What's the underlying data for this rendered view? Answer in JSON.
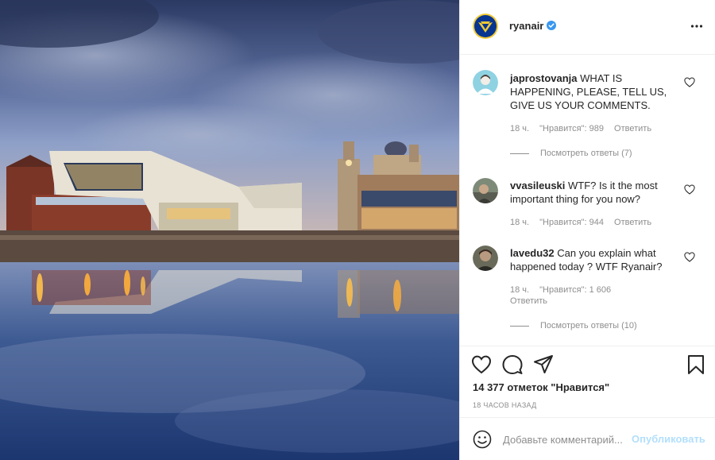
{
  "post": {
    "author": {
      "username": "ryanair",
      "verified": true
    }
  },
  "comments": [
    {
      "username": "japrostovanja",
      "text": "WHAT IS HAPPENING, PLEASE, TELL US, GIVE US YOUR COMMENTS.",
      "time": "18 ч.",
      "likes": "\"Нравится\": 989",
      "reply": "Ответить",
      "view_replies": "Посмотреть ответы (7)"
    },
    {
      "username": "vvasileuski",
      "text": "WTF? Is it the most important thing for you now?",
      "time": "18 ч.",
      "likes": "\"Нравится\": 944",
      "reply": "Ответить"
    },
    {
      "username": "lavedu32",
      "text": "Can you explain what happened today ? WTF Ryanair?",
      "time": "18 ч.",
      "likes": "\"Нравится\": 1 606",
      "reply": "Ответить",
      "view_replies": "Посмотреть ответы (10)"
    }
  ],
  "likes_count": "14 377 отметок \"Нравится\"",
  "time_ago": "18 ЧАСОВ НАЗАД",
  "add_comment": {
    "placeholder": "Добавьте комментарий...",
    "publish_label": "Опубликовать"
  },
  "icons": {
    "verified": "verified-badge-icon",
    "more": "more-options-icon",
    "like": "heart-icon",
    "comment": "comment-icon",
    "share": "paper-plane-icon",
    "save": "bookmark-icon",
    "emoji": "smiley-icon"
  },
  "colors": {
    "verified_blue": "#3897f0",
    "muted_text": "#8e8e8e",
    "publish_disabled": "#b2dffc"
  }
}
